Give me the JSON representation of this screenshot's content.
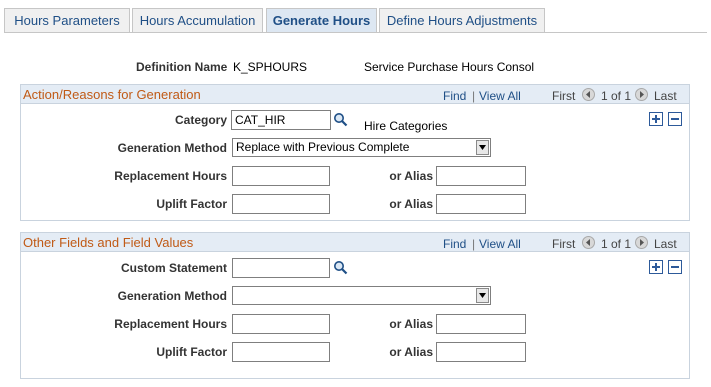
{
  "tabs": [
    {
      "label": "Hours Parameters",
      "active": false
    },
    {
      "label": "Hours Accumulation",
      "active": false
    },
    {
      "label": "Generate Hours",
      "active": true
    },
    {
      "label": "Define Hours Adjustments",
      "active": false
    }
  ],
  "header": {
    "definition_label": "Definition Name",
    "definition_value": "K_SPHOURS",
    "definition_desc": "Service Purchase Hours Consol"
  },
  "group1": {
    "title": "Action/Reasons for Generation",
    "find": "Find",
    "view_all": "View All",
    "first": "First",
    "range": "1 of 1",
    "last": "Last",
    "category_label": "Category",
    "category_value": "CAT_HIR",
    "category_desc": "Hire Categories",
    "method_label": "Generation Method",
    "method_value": "Replace with Previous Complete",
    "replacement_label": "Replacement Hours",
    "replacement_value": "",
    "uplift_label": "Uplift Factor",
    "uplift_value": "",
    "alias_label": "or Alias",
    "alias1_value": "",
    "alias2_value": ""
  },
  "group2": {
    "title": "Other Fields and Field Values",
    "find": "Find",
    "view_all": "View All",
    "first": "First",
    "range": "1 of 1",
    "last": "Last",
    "custom_label": "Custom Statement",
    "custom_value": "",
    "method_label": "Generation Method",
    "method_value": "",
    "replacement_label": "Replacement Hours",
    "replacement_value": "",
    "uplift_label": "Uplift Factor",
    "uplift_value": "",
    "alias_label": "or Alias",
    "alias1_value": "",
    "alias2_value": ""
  },
  "colors": {
    "group_title": "#c05a16",
    "link": "#1f4f86",
    "group_header_bg": "#e4ecf5"
  },
  "icons": [
    "lookup-icon",
    "nav-first-icon",
    "nav-last-icon",
    "add-row-icon",
    "delete-row-icon",
    "dropdown-arrow-icon"
  ]
}
